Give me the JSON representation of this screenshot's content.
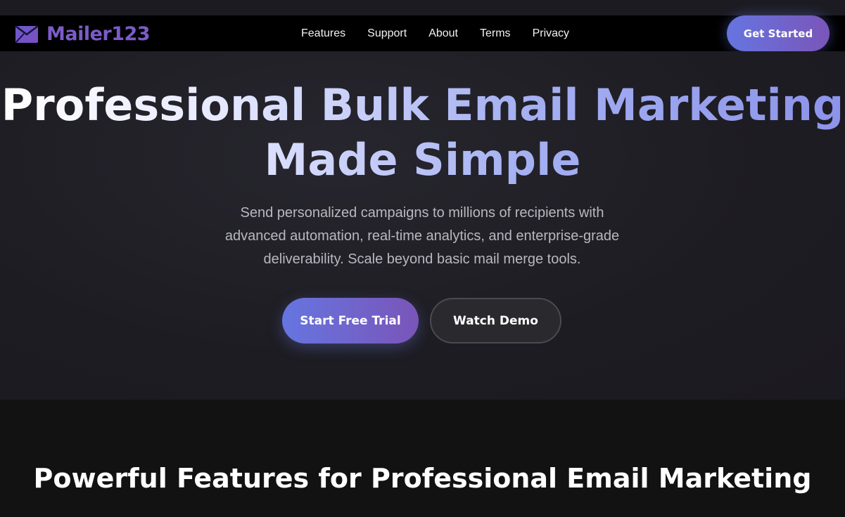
{
  "brand": {
    "name": "Mailer123",
    "icon": "paper-plane-mail-icon",
    "color": "#7b5cc8"
  },
  "nav": {
    "links": [
      "Features",
      "Support",
      "About",
      "Terms",
      "Privacy"
    ],
    "cta": "Get Started"
  },
  "hero": {
    "title_line1": "Professional Bulk Email Marketing",
    "title_line2": "Made Simple",
    "subtitle": "Send personalized campaigns to millions of recipients with advanced automation, real-time analytics, and enterprise-grade deliverability. Scale beyond basic mail merge tools.",
    "primary_button": "Start Free Trial",
    "secondary_button": "Watch Demo"
  },
  "features": {
    "title": "Powerful Features for Professional Email Marketing"
  },
  "colors": {
    "accent_start": "#6675e0",
    "accent_end": "#7a55b8",
    "background": "#1a1a1f"
  }
}
